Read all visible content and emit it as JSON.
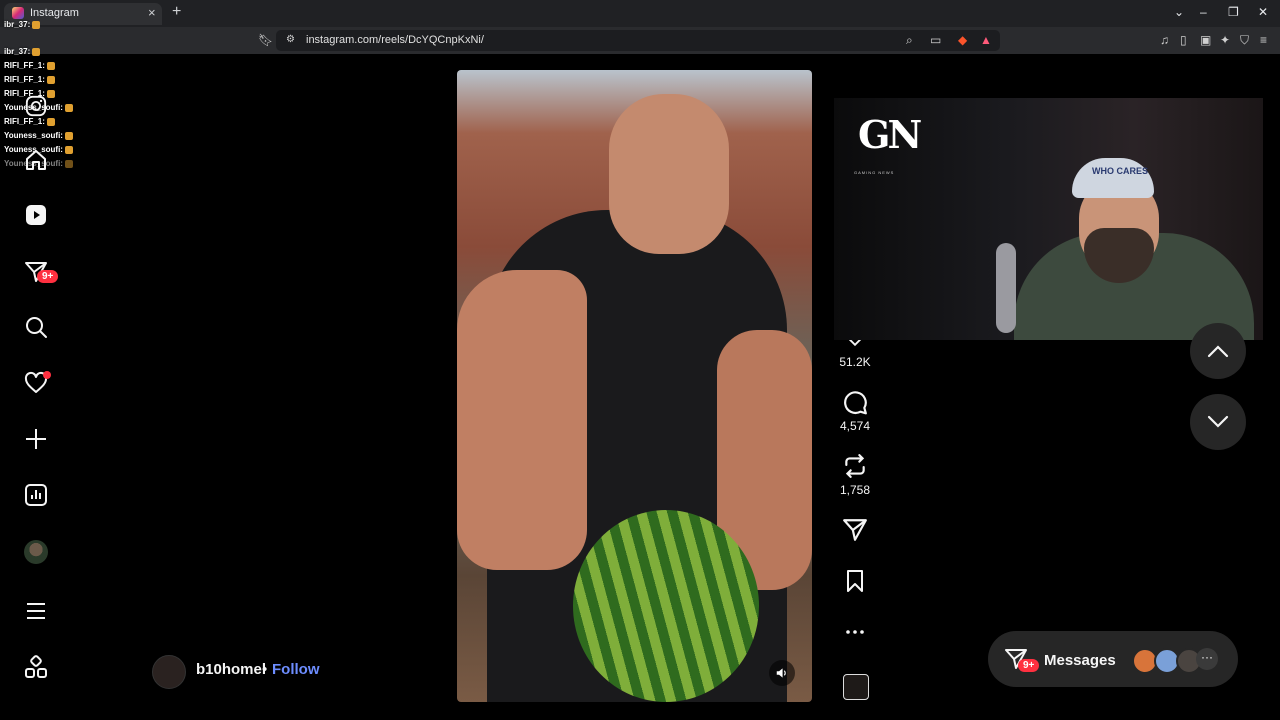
{
  "browser": {
    "tab_title": "Instagram",
    "url": "instagram.com/reels/DcYQCnpKxNi/",
    "new_tab": "+",
    "tab_close": "×",
    "win_minimize": "–",
    "win_restore": "❐",
    "win_close": "✕"
  },
  "chat_overlay": {
    "messages": [
      "ibr_37:",
      "ibr_37:",
      "RIFI_FF_1:",
      "RIFI_FF_1:",
      "RIFI_FF_1:",
      "Youness_soufi:",
      "RIFI_FF_1:",
      "Youness_soufi:",
      "Youness_soufi:",
      "Youness_soufi:"
    ]
  },
  "sidebar": {
    "notifications_badge": "9+"
  },
  "reel": {
    "author": "b10homel",
    "separator": "•",
    "follow_label": "Follow",
    "likes": "51.2K",
    "comments": "4,574",
    "reposts": "1,758"
  },
  "webcam": {
    "logo": "GN",
    "logo_sub": "GAMING NEWS",
    "cap_text": "WHO CARES"
  },
  "messages": {
    "label": "Messages",
    "badge": "9+",
    "more": "···"
  },
  "colors": {
    "accent_link": "#6d8dff",
    "badge_red": "#ff3040",
    "background": "#000000"
  }
}
